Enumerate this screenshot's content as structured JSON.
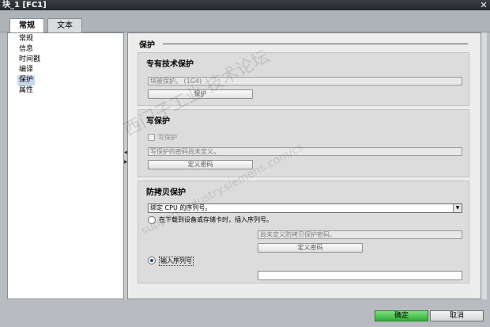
{
  "window": {
    "title": "块_1 [FC1]",
    "close_glyph": "✕"
  },
  "tabs": [
    {
      "label": "常规",
      "active": true
    },
    {
      "label": "文本",
      "active": false
    }
  ],
  "nav": {
    "items": [
      {
        "label": "常规",
        "selected": false
      },
      {
        "label": "信息",
        "selected": false
      },
      {
        "label": "时间戳",
        "selected": false
      },
      {
        "label": "编译",
        "selected": false
      },
      {
        "label": "保护",
        "selected": true
      },
      {
        "label": "属性",
        "selected": false
      }
    ]
  },
  "page": {
    "heading": "保护"
  },
  "know_how": {
    "title": "专有技术保护",
    "status": "块被保护。 (1G4)",
    "button_label": "保护"
  },
  "write": {
    "title": "写保护",
    "checkbox_label": "写保护",
    "password_status": "写保护的密码尚未定义。",
    "button_label": "定义密码"
  },
  "copy": {
    "title": "防拷贝保护",
    "select_value": "绑定 CPU 的序列号。",
    "option_download": "在下载到设备或存储卡时，插入序列号。",
    "password_status": "尚未定义防拷贝保护密码。",
    "button_label": "定义密码",
    "option_enter": "输入序列号",
    "serial_value": ""
  },
  "footer": {
    "ok_label": "确定",
    "cancel_label": "取消"
  },
  "watermark": {
    "line1": "西门子工业  技术论坛",
    "line2": "support.industry.siemens.com/cs"
  },
  "colors": {
    "ok_button": "#2fae3a",
    "title_bar": "#2a2e33",
    "selection": "#c8d8ec"
  }
}
